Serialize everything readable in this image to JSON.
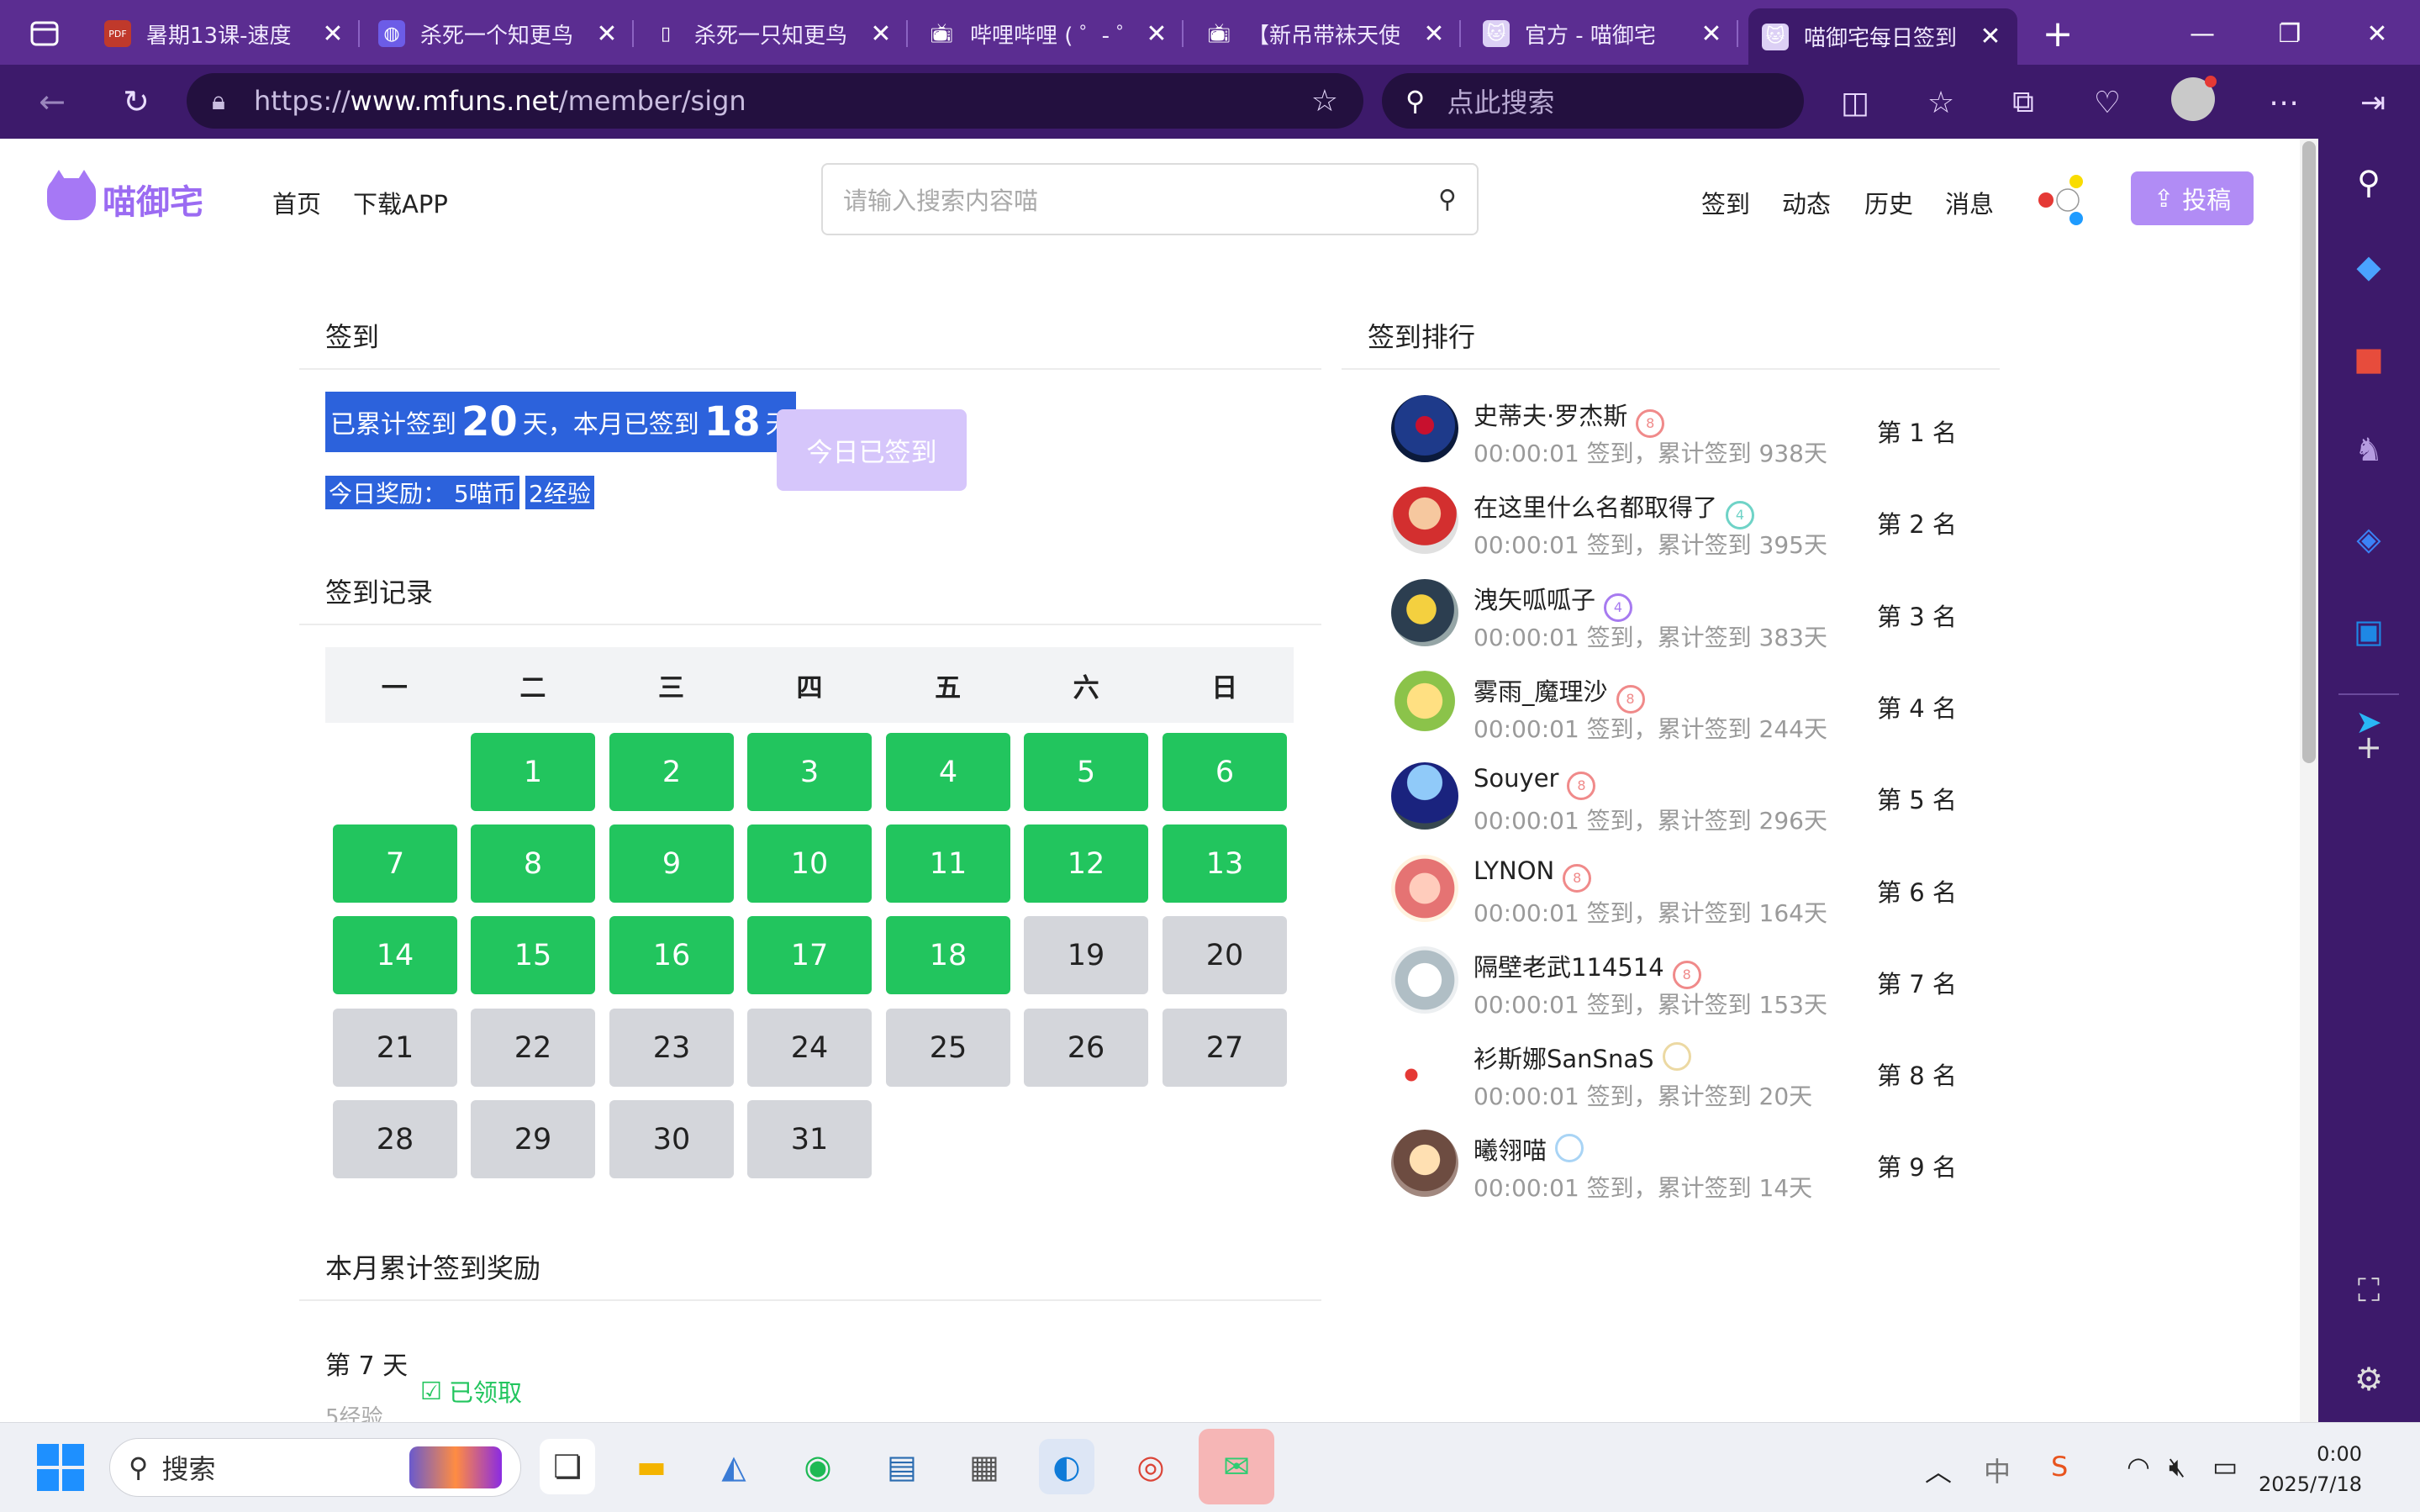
{
  "browser": {
    "tabs": [
      {
        "title": "暑期13课-速度",
        "icon": "pdf-icon",
        "active": false
      },
      {
        "title": "杀死一个知更鸟",
        "icon": "copilot-icon",
        "active": false
      },
      {
        "title": "杀死一只知更鸟",
        "icon": "document-icon",
        "active": false
      },
      {
        "title": "哔哩哔哩 ( ゜- ゜",
        "icon": "bilibili-icon",
        "active": false
      },
      {
        "title": "【新吊带袜天使",
        "icon": "bilibili-icon",
        "active": false
      },
      {
        "title": "官方 - 喵御宅",
        "icon": "mfuns-icon",
        "active": false
      },
      {
        "title": "喵御宅每日签到",
        "icon": "mfuns-icon",
        "active": true
      }
    ],
    "tab_close_glyph": "✕",
    "url_prefix": "https://",
    "url_host": "www.mfuns.net",
    "url_path": "/member/sign",
    "search_placeholder": "点此搜索"
  },
  "site": {
    "logo_text": "喵御宅",
    "nav": {
      "home": "首页",
      "download_app": "下载APP"
    },
    "search_placeholder": "请输入搜索内容喵",
    "right_nav": {
      "sign": "签到",
      "feed": "动态",
      "history": "历史",
      "messages": "消息"
    },
    "post_button": "投稿"
  },
  "sign": {
    "section_title": "签到",
    "stat_prefix": "已累计签到",
    "total_days": "20",
    "stat_mid": "天，本月已签到",
    "month_days": "18",
    "stat_suffix": "天",
    "reward_label": "今日奖励：",
    "reward_coins": "5喵币",
    "reward_exp": "2经验",
    "signed_button": "今日已签到"
  },
  "record": {
    "section_title": "签到记录",
    "weekdays": [
      "一",
      "二",
      "三",
      "四",
      "五",
      "六",
      "日"
    ],
    "first_weekday_index": 1,
    "days_in_month": 31,
    "signed_through": 18
  },
  "monthly_reward": {
    "section_title": "本月累计签到奖励",
    "day_label": "第 7 天",
    "claimed_label": "已领取",
    "exp_label": "5经验"
  },
  "ranking": {
    "section_title": "签到排行",
    "items": [
      {
        "name": "史蒂夫·罗杰斯",
        "meta": "00:00:01 签到，累计签到 938天",
        "rank": "第 1 名",
        "badge_color": "#f08a8a",
        "badge_text": "8"
      },
      {
        "name": "在这里什么名都取得了",
        "meta": "00:00:01 签到，累计签到 395天",
        "rank": "第 2 名",
        "badge_color": "#6fd3c7",
        "badge_text": "4"
      },
      {
        "name": "洩矢呱呱子",
        "meta": "00:00:01 签到，累计签到 383天",
        "rank": "第 3 名",
        "badge_color": "#a77bf0",
        "badge_text": "4"
      },
      {
        "name": "雾雨_魔理沙",
        "meta": "00:00:01 签到，累计签到 244天",
        "rank": "第 4 名",
        "badge_color": "#f08a8a",
        "badge_text": "8"
      },
      {
        "name": "Souyer",
        "meta": "00:00:01 签到，累计签到 296天",
        "rank": "第 5 名",
        "badge_color": "#f08a8a",
        "badge_text": "8"
      },
      {
        "name": "LYNON",
        "meta": "00:00:01 签到，累计签到 164天",
        "rank": "第 6 名",
        "badge_color": "#f08a8a",
        "badge_text": "8"
      },
      {
        "name": "隔壁老武114514",
        "meta": "00:00:01 签到，累计签到 153天",
        "rank": "第 7 名",
        "badge_color": "#f08a8a",
        "badge_text": "8"
      },
      {
        "name": "衫斯娜SanSnaS",
        "meta": "00:00:01 签到，累计签到 20天",
        "rank": "第 8 名",
        "badge_color": "#ecd9a3",
        "badge_text": ""
      },
      {
        "name": "曦翎喵",
        "meta": "00:00:01 签到，累计签到 14天",
        "rank": "第 9 名",
        "badge_color": "#a9d4f5",
        "badge_text": ""
      }
    ]
  },
  "taskbar": {
    "search_label": "搜索",
    "ime_label": "中",
    "time": "0:00",
    "date": "2025/7/18"
  },
  "colors": {
    "tabbar": "#5b2d91",
    "toolbar": "#3d1a6b",
    "brand": "#a678f5",
    "signed": "#22c55e",
    "unsigned": "#d4d6db",
    "highlight": "#2c62dc"
  }
}
